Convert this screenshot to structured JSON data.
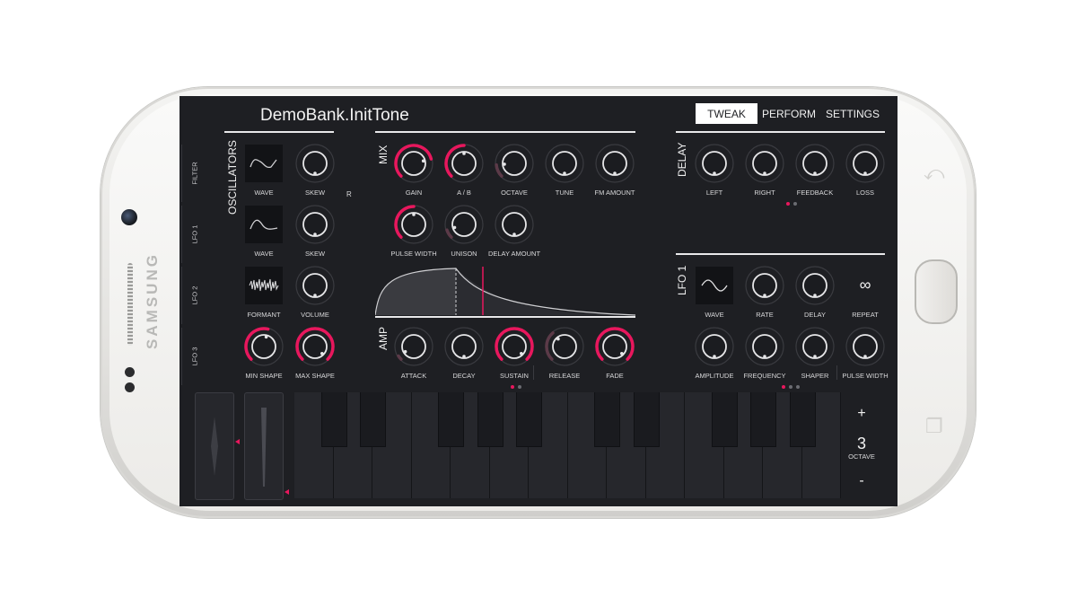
{
  "device": {
    "brand": "SAMSUNG"
  },
  "header": {
    "patch_name": "DemoBank.InitTone",
    "tabs": [
      {
        "label": "TWEAK",
        "active": true
      },
      {
        "label": "PERFORM",
        "active": false
      },
      {
        "label": "SETTINGS",
        "active": false
      }
    ]
  },
  "side_tabs": [
    "FILTER",
    "LFO 1",
    "LFO 2",
    "LFO 3"
  ],
  "oscillators": {
    "title": "OSCILLATORS",
    "labels": [
      "WAVE",
      "SKEW",
      "WAVE",
      "SKEW",
      "FORMANT",
      "VOLUME",
      "MIN SHAPE",
      "MAX SHAPE"
    ],
    "r_label": "R"
  },
  "mix": {
    "title": "MIX",
    "labels": [
      "GAIN",
      "A / B",
      "OCTAVE",
      "TUNE",
      "FM AMOUNT",
      "PULSE WIDTH",
      "UNISON",
      "DELAY AMOUNT"
    ]
  },
  "amp": {
    "title": "AMP",
    "labels": [
      "ATTACK",
      "DECAY",
      "SUSTAIN",
      "RELEASE",
      "FADE"
    ]
  },
  "delay": {
    "title": "DELAY",
    "labels": [
      "LEFT",
      "RIGHT",
      "FEEDBACK",
      "LOSS"
    ]
  },
  "lfo1": {
    "title": "LFO 1",
    "labels": [
      "WAVE",
      "RATE",
      "DELAY",
      "REPEAT",
      "AMPLITUDE",
      "FREQUENCY",
      "SHAPER",
      "PULSE WIDTH"
    ],
    "repeat_symbol": "∞"
  },
  "keyboard": {
    "octave_value": "3",
    "octave_label": "OCTAVE",
    "plus": "+",
    "minus": "-"
  },
  "colors": {
    "accent": "#e8175d",
    "background": "#1e1f23",
    "knob_track": "#5b3a48"
  }
}
